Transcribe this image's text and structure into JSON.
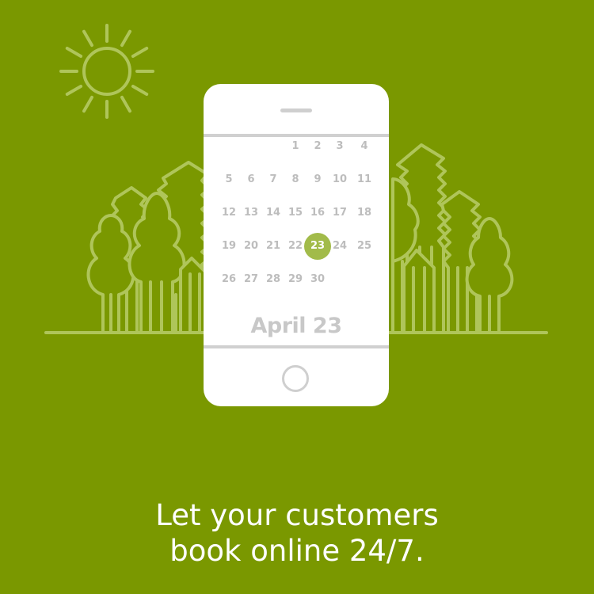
{
  "colors": {
    "background": "#7a9800",
    "illustration_line": "#afc55a",
    "selected_day": "#a2bb4a",
    "phone": "#ffffff",
    "muted_text": "#bdbdbd"
  },
  "icons": [
    "sun-icon",
    "trees-illustration",
    "smartphone-icon"
  ],
  "calendar": {
    "month": "April",
    "weeks": [
      [
        "",
        "",
        "",
        "1",
        "2",
        "3",
        "4"
      ],
      [
        "5",
        "6",
        "7",
        "8",
        "9",
        "10",
        "11"
      ],
      [
        "12",
        "13",
        "14",
        "15",
        "16",
        "17",
        "18"
      ],
      [
        "19",
        "20",
        "21",
        "22",
        "23",
        "24",
        "25"
      ],
      [
        "26",
        "27",
        "28",
        "29",
        "30",
        "",
        ""
      ]
    ],
    "selected_day": "23",
    "selected_label": "April 23"
  },
  "tagline": {
    "line1": "Let your customers",
    "line2": "book online 24/7."
  }
}
